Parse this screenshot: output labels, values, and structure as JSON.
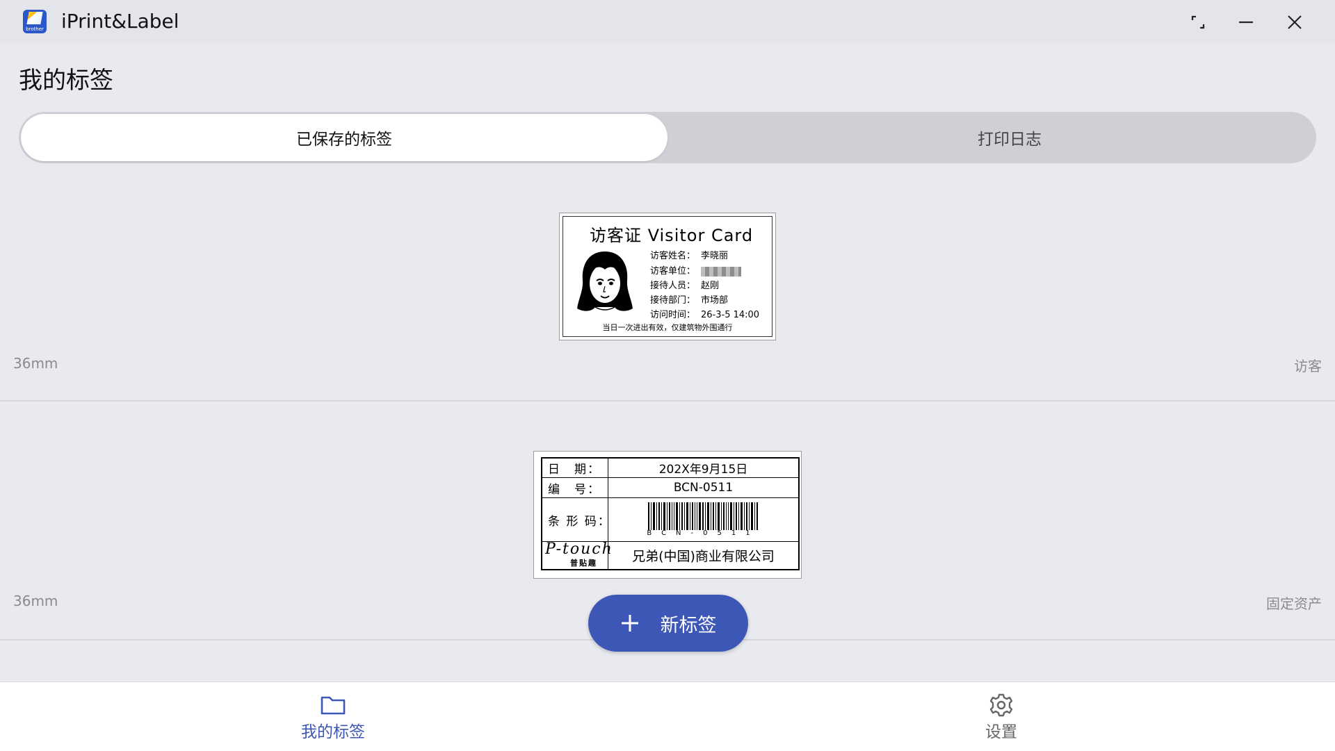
{
  "window": {
    "app_name": "iPrint&Label",
    "logo_text": "brother"
  },
  "page": {
    "title": "我的标签"
  },
  "tabs": [
    {
      "label": "已保存的标签",
      "active": true
    },
    {
      "label": "打印日志",
      "active": false
    }
  ],
  "labels": [
    {
      "size": "36mm",
      "category": "访客",
      "preview": {
        "title": "访客证 Visitor Card",
        "fields": [
          {
            "key": "访客姓名：",
            "value": "李晓丽"
          },
          {
            "key": "访客单位：",
            "value": ""
          },
          {
            "key": "接待人员：",
            "value": "赵刚"
          },
          {
            "key": "接待部门：",
            "value": "市场部"
          },
          {
            "key": "访问时间：",
            "value": "26-3-5 14:00"
          }
        ],
        "footer": "当日一次进出有效，仅建筑物外围通行"
      }
    },
    {
      "size": "36mm",
      "category": "固定资产",
      "preview": {
        "rows": [
          {
            "key": "日　期：",
            "value": "202X年9月15日"
          },
          {
            "key": "编　号：",
            "value": "BCN-0511"
          },
          {
            "key": "条 形 码：",
            "value": "BCN-0511"
          }
        ],
        "brand_script": "P-touch",
        "brand_sub": "普贴趣",
        "company": "兄弟(中国)商业有限公司"
      }
    }
  ],
  "fab": {
    "icon": "plus-icon",
    "label": "新标签"
  },
  "bottom_nav": [
    {
      "label": "我的标签",
      "icon": "folder-icon",
      "active": true
    },
    {
      "label": "设置",
      "icon": "gear-icon",
      "active": false
    }
  ],
  "colors": {
    "accent": "#3d57b6",
    "background": "#e9eaef",
    "titlebar": "#e4e5ea"
  }
}
